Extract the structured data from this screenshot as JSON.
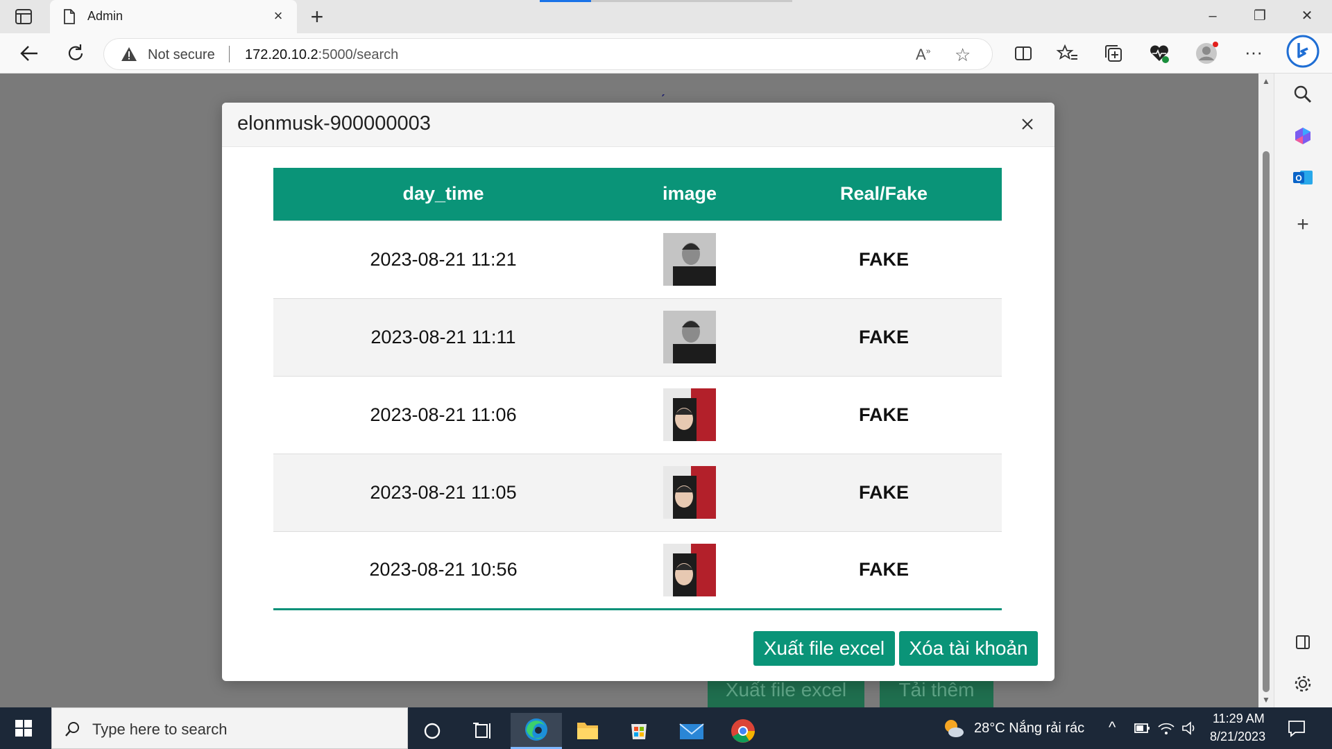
{
  "browser": {
    "tab_title": "Admin",
    "omnibox": {
      "security_label": "Not secure",
      "url_host": "172.20.10.2",
      "url_rest": ":5000/search"
    }
  },
  "background_page": {
    "export_label": "Xuất file excel",
    "load_more_label": "Tải thêm"
  },
  "modal": {
    "title": "elonmusk-900000003",
    "columns": [
      "day_time",
      "image",
      "Real/Fake"
    ],
    "rows": [
      {
        "day_time": "2023-08-21 11:21",
        "image": "face-thumbnail-gray",
        "verdict": "FAKE"
      },
      {
        "day_time": "2023-08-21 11:11",
        "image": "face-thumbnail-gray",
        "verdict": "FAKE"
      },
      {
        "day_time": "2023-08-21 11:06",
        "image": "face-thumbnail-red",
        "verdict": "FAKE"
      },
      {
        "day_time": "2023-08-21 11:05",
        "image": "face-thumbnail-red",
        "verdict": "FAKE"
      },
      {
        "day_time": "2023-08-21 10:56",
        "image": "face-thumbnail-red",
        "verdict": "FAKE"
      }
    ],
    "export_button": "Xuất file excel",
    "delete_button": "Xóa tài khoản"
  },
  "taskbar": {
    "search_placeholder": "Type here to search",
    "weather": "28°C  Nắng rải rác",
    "time": "11:29 AM",
    "date": "8/21/2023"
  },
  "colors": {
    "accent": "#0a9478",
    "fake": "#e21b1b",
    "overlay": "#7a7a7a"
  }
}
